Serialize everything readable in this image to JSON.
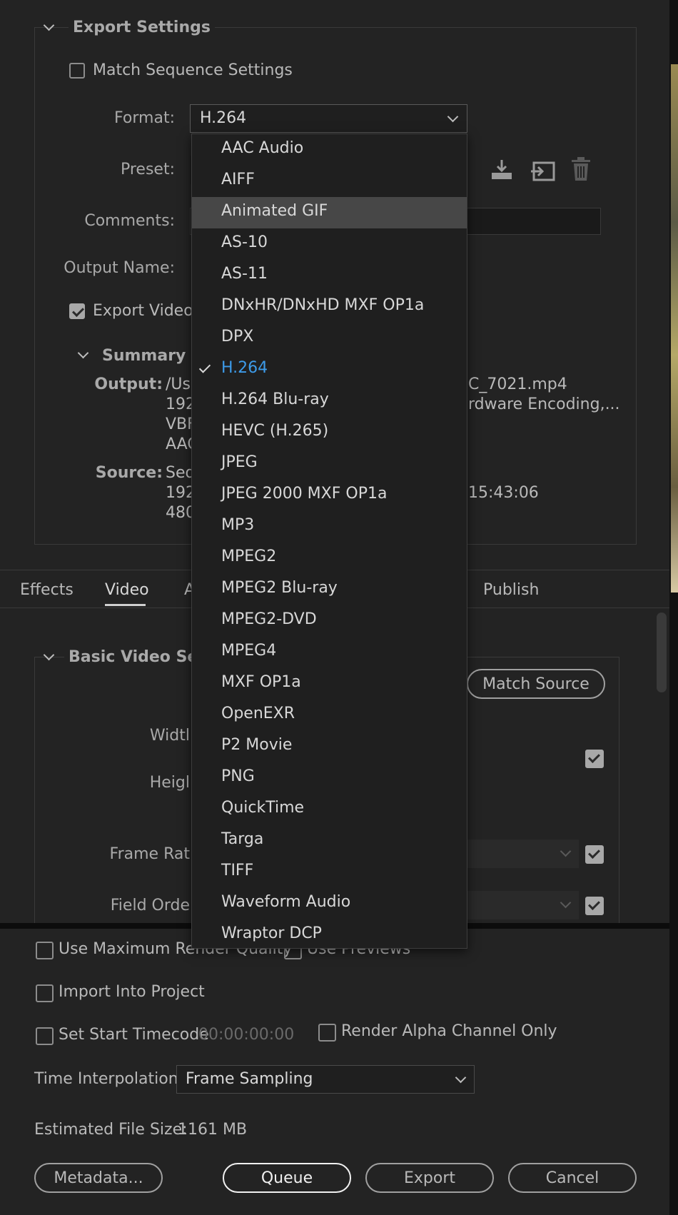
{
  "export_settings": {
    "section_title": "Export Settings",
    "match_sequence_label": "Match Sequence Settings",
    "format_label": "Format:",
    "format_value": "H.264",
    "preset_label": "Preset:",
    "comments_label": "Comments:",
    "output_name_label": "Output Name:",
    "export_video_label": "Export Video",
    "summary_title": "Summary",
    "summary": {
      "output_key": "Output:",
      "output_lines": [
        "/Us",
        "192",
        "VBF",
        "AAC"
      ],
      "output_right_lines": [
        "C_7021.mp4",
        "rdware Encoding,..."
      ],
      "source_key": "Source:",
      "source_lines": [
        "Seq",
        "192",
        "480"
      ],
      "source_right": "15:43:06"
    }
  },
  "format_menu": {
    "items": [
      "AAC Audio",
      "AIFF",
      "Animated GIF",
      "AS-10",
      "AS-11",
      "DNxHR/DNxHD MXF OP1a",
      "DPX",
      "H.264",
      "H.264 Blu-ray",
      "HEVC (H.265)",
      "JPEG",
      "JPEG 2000 MXF OP1a",
      "MP3",
      "MPEG2",
      "MPEG2 Blu-ray",
      "MPEG2-DVD",
      "MPEG4",
      "MXF OP1a",
      "OpenEXR",
      "P2 Movie",
      "PNG",
      "QuickTime",
      "Targa",
      "TIFF",
      "Waveform Audio",
      "Wraptor DCP"
    ],
    "hovered": "Animated GIF",
    "selected": "H.264"
  },
  "tabs": {
    "effects": "Effects",
    "video": "Video",
    "audio_partial": "A",
    "publish": "Publish"
  },
  "basic_video": {
    "section_title": "Basic Video Setti",
    "match_source_button": "Match Source",
    "width_label": "Widtl",
    "height_label": "Heigl",
    "frame_rate_label": "Frame Rat",
    "field_order_label": "Field Orde"
  },
  "bottom": {
    "max_render_quality_label": "Use Maximum Render Quality",
    "use_previews_label": "Use Previews",
    "import_into_project_label": "Import Into Project",
    "set_start_timecode_label": "Set Start Timecode",
    "start_timecode_value": "00:00:00:00",
    "render_alpha_label": "Render Alpha Channel Only",
    "time_interpolation_label": "Time Interpolation:",
    "time_interpolation_value": "Frame Sampling",
    "estimated_size_label": "Estimated File Size:",
    "estimated_size_value": "1161 MB"
  },
  "buttons": {
    "metadata": "Metadata...",
    "queue": "Queue",
    "export": "Export",
    "cancel": "Cancel"
  },
  "colors": {
    "background": "#232323",
    "accent_selected": "#3d9be9",
    "hover_row": "#474747"
  }
}
